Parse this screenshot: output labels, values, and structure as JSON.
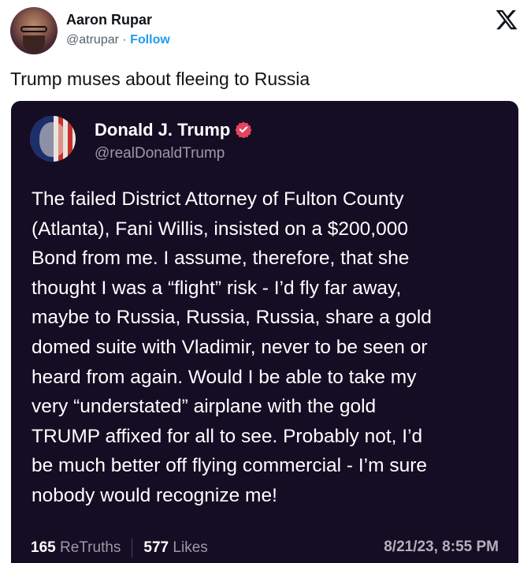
{
  "tweet": {
    "author_name": "Aaron Rupar",
    "author_handle": "@atrupar",
    "separator": "·",
    "follow_label": "Follow",
    "text": "Trump muses about fleeing to Russia"
  },
  "embedded_post": {
    "name": "Donald J. Trump",
    "handle": "@realDonaldTrump",
    "body_lines": [
      "The failed District Attorney of Fulton County",
      "(Atlanta), Fani Willis, insisted on a $200,000",
      "Bond from me. I assume, therefore, that she",
      "thought I was a “flight” risk - I’d fly far away,",
      "maybe to Russia, Russia, Russia, share a gold",
      "domed suite with Vladimir, never to be seen or",
      "heard from again. Would I be able to take my",
      "very “understated” airplane with the gold",
      "TRUMP affixed for all to see. Probably not, I’d",
      "be much better off flying commercial - I’m sure",
      "nobody would recognize me!"
    ],
    "retruths_count": "165",
    "retruths_label": "ReTruths",
    "likes_count": "577",
    "likes_label": "Likes",
    "timestamp": "8/21/23, 8:55 PM"
  },
  "icons": {
    "platform": "x-logo-icon",
    "verified": "verified-badge-icon"
  },
  "colors": {
    "link": "#1d9bf0",
    "card_background": "#140d24",
    "verified_badge": "#e6435f"
  }
}
